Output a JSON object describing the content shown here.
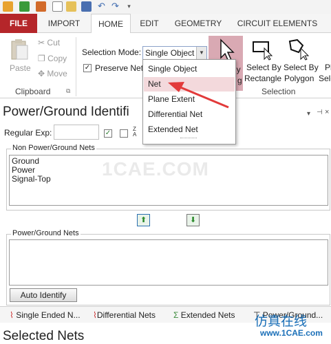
{
  "qat": {
    "icons": [
      "app-logo-icon",
      "import-icon",
      "wrench-icon",
      "new-file-icon",
      "open-folder-icon",
      "save-icon",
      "undo-icon",
      "redo-icon",
      "dropdown-icon"
    ]
  },
  "tabs": [
    "FILE",
    "IMPORT",
    "HOME",
    "EDIT",
    "GEOMETRY",
    "CIRCUIT ELEMENTS"
  ],
  "active_tab": "HOME",
  "clipboard": {
    "paste": "Paste",
    "cut": "Cut",
    "copy": "Copy",
    "move": "Move",
    "label": "Clipboard"
  },
  "selection": {
    "mode_label": "Selection Mode:",
    "mode_value": "Single Object",
    "preserve_net": "Preserve Net",
    "preserve_checked": true,
    "partial_text_1": "ly",
    "partial_text_2": "g",
    "rect_l1": "Select By",
    "rect_l2": "Rectangle",
    "poly_l1": "Select By",
    "poly_l2": "Polygon",
    "cut_l1": "Pl",
    "cut_l2": "Sele",
    "label": "Selection"
  },
  "dropdown": {
    "items": [
      "Single Object",
      "Net",
      "Plane Extent",
      "Differential Net",
      "Extended Net"
    ],
    "hovered": "Net"
  },
  "panel": {
    "title": "Power/Ground Identifi",
    "regex_label": "Regular Exp:",
    "non_pg_title": "Non Power/Ground Nets",
    "non_pg_items": [
      "Ground",
      "Power",
      "Signal-Top"
    ],
    "pg_title": "Power/Ground Nets",
    "pg_items": [],
    "auto_identify": "Auto Identify"
  },
  "bottom_tabs": [
    "Single Ended N...",
    "Differential Nets",
    "Extended Nets",
    "Power/Ground..."
  ],
  "selected_nets": "Selected Nets",
  "watermark": "1CAE.COM",
  "corner_watermark": {
    "cn": "仿真在线",
    "url": "www.1CAE.com"
  },
  "colors": {
    "file_tab": "#b5262a",
    "selection_highlight": "#d9a9b3",
    "dropdown_hover": "#f3d9dc",
    "annotation_arrow": "#e23a3a"
  }
}
